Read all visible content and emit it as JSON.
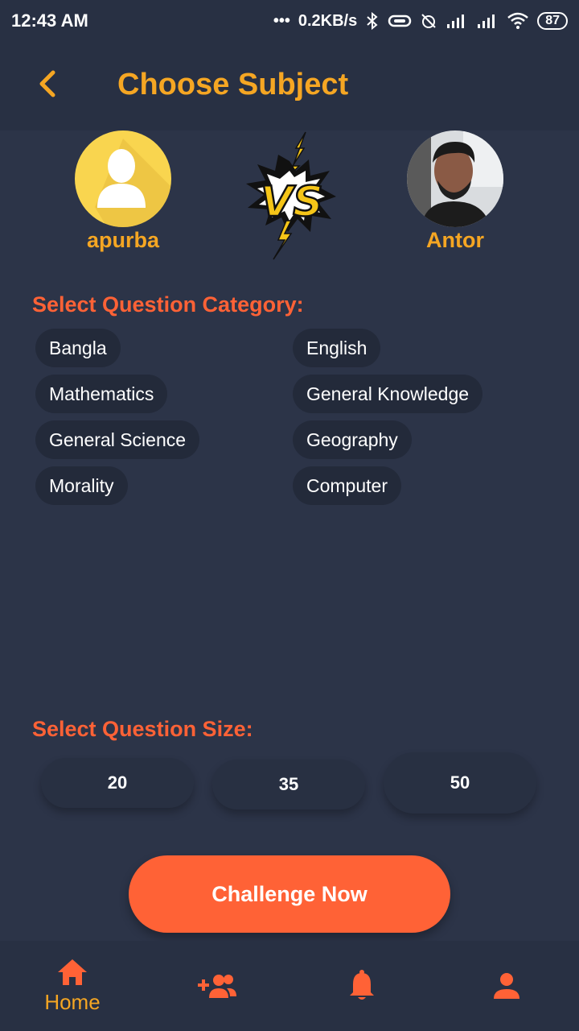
{
  "status_bar": {
    "time": "12:43 AM",
    "dots": "•••",
    "network_speed": "0.2KB/s",
    "battery": "87"
  },
  "header": {
    "title": "Choose Subject",
    "back_icon": "chevron-left-icon"
  },
  "players": {
    "left": {
      "name": "apurba",
      "avatar": "default-user-icon"
    },
    "right": {
      "name": "Antor",
      "avatar": "user-photo"
    },
    "vs_icon": "vs-lightning-icon"
  },
  "category": {
    "label": "Select Question Category:",
    "items": [
      "Bangla",
      "English",
      "Mathematics",
      "General Knowledge",
      "General Science",
      "Geography",
      "Morality",
      "Computer"
    ]
  },
  "size": {
    "label": "Select Question Size:",
    "options": [
      "20",
      "35",
      "50"
    ]
  },
  "challenge_button": "Challenge Now",
  "bottom_nav": {
    "items": [
      {
        "icon": "home-icon",
        "label": "Home"
      },
      {
        "icon": "add-friend-icon",
        "label": ""
      },
      {
        "icon": "bell-icon",
        "label": ""
      },
      {
        "icon": "person-icon",
        "label": ""
      }
    ]
  },
  "colors": {
    "background": "#2c3448",
    "accent_yellow": "#f5a623",
    "accent_orange": "#ff6236",
    "chip_bg": "#232a3a"
  }
}
